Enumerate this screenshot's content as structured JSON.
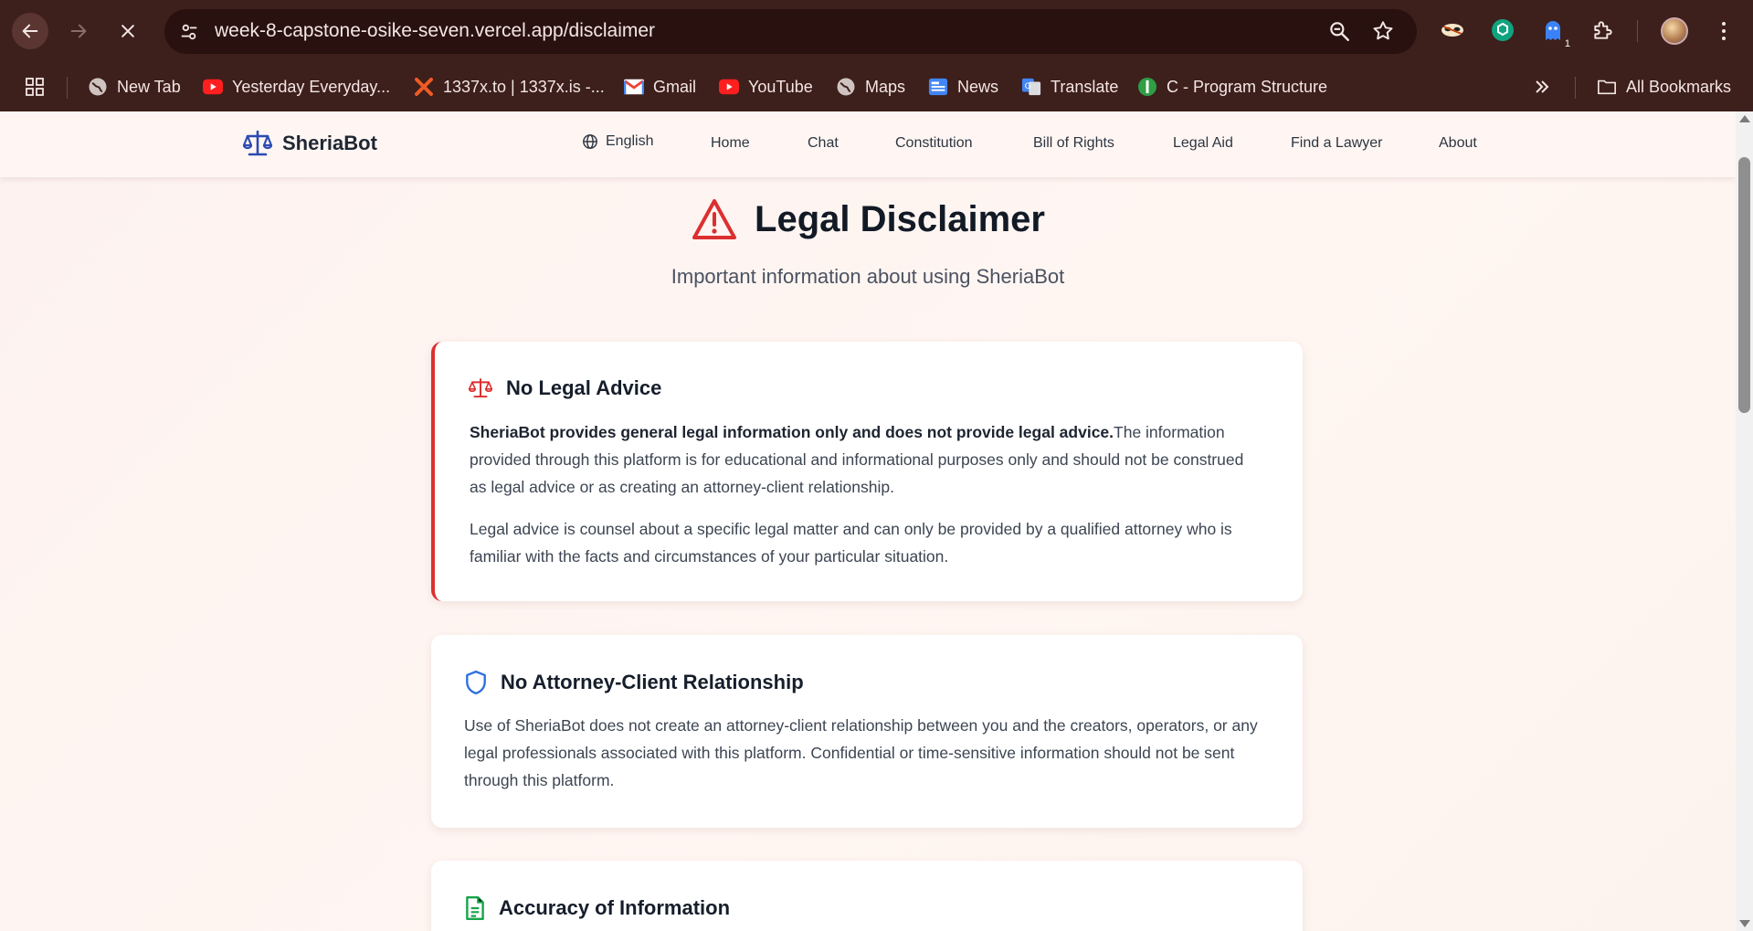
{
  "browser": {
    "url": "week-8-capstone-osike-seven.vercel.app/disclaimer",
    "extension_badge": "1",
    "bookmarks": [
      {
        "label": "New Tab",
        "icon": "globe-icon"
      },
      {
        "label": "Yesterday Everyday...",
        "icon": "youtube-icon"
      },
      {
        "label": "1337x.to | 1337x.is -...",
        "icon": "x-logo-icon"
      },
      {
        "label": "Gmail",
        "icon": "gmail-icon"
      },
      {
        "label": "YouTube",
        "icon": "youtube-icon"
      },
      {
        "label": "Maps",
        "icon": "globe-icon"
      },
      {
        "label": "News",
        "icon": "news-icon"
      },
      {
        "label": "Translate",
        "icon": "translate-icon"
      },
      {
        "label": "C - Program Structure",
        "icon": "site-icon"
      }
    ],
    "all_bookmarks_label": "All Bookmarks"
  },
  "site": {
    "brand": "SheriaBot",
    "language": "English",
    "nav": [
      "Home",
      "Chat",
      "Constitution",
      "Bill of Rights",
      "Legal Aid",
      "Find a Lawyer",
      "About"
    ]
  },
  "hero": {
    "title": "Legal Disclaimer",
    "subtitle": "Important information about using SheriaBot"
  },
  "sections": [
    {
      "title": "No Legal Advice",
      "icon": "scale-icon",
      "strong": "SheriaBot provides general legal information only and does not provide legal advice.",
      "p1_rest": "The information provided through this platform is for educational and informational purposes only and should not be construed as legal advice or as creating an attorney-client relationship.",
      "p2": "Legal advice is counsel about a specific legal matter and can only be provided by a qualified attorney who is familiar with the facts and circumstances of your particular situation."
    },
    {
      "title": "No Attorney-Client Relationship",
      "icon": "shield-icon",
      "p1": "Use of SheriaBot does not create an attorney-client relationship between you and the creators, operators, or any legal professionals associated with this platform. Confidential or time-sensitive information should not be sent through this platform."
    },
    {
      "title": "Accuracy of Information",
      "icon": "document-icon"
    }
  ],
  "colors": {
    "chrome_bg": "#3d1f1c",
    "accent_red": "#dc2f2f",
    "brand_blue": "#2b4bb3",
    "shield_blue": "#2f6fe0",
    "doc_green": "#16a34a"
  }
}
